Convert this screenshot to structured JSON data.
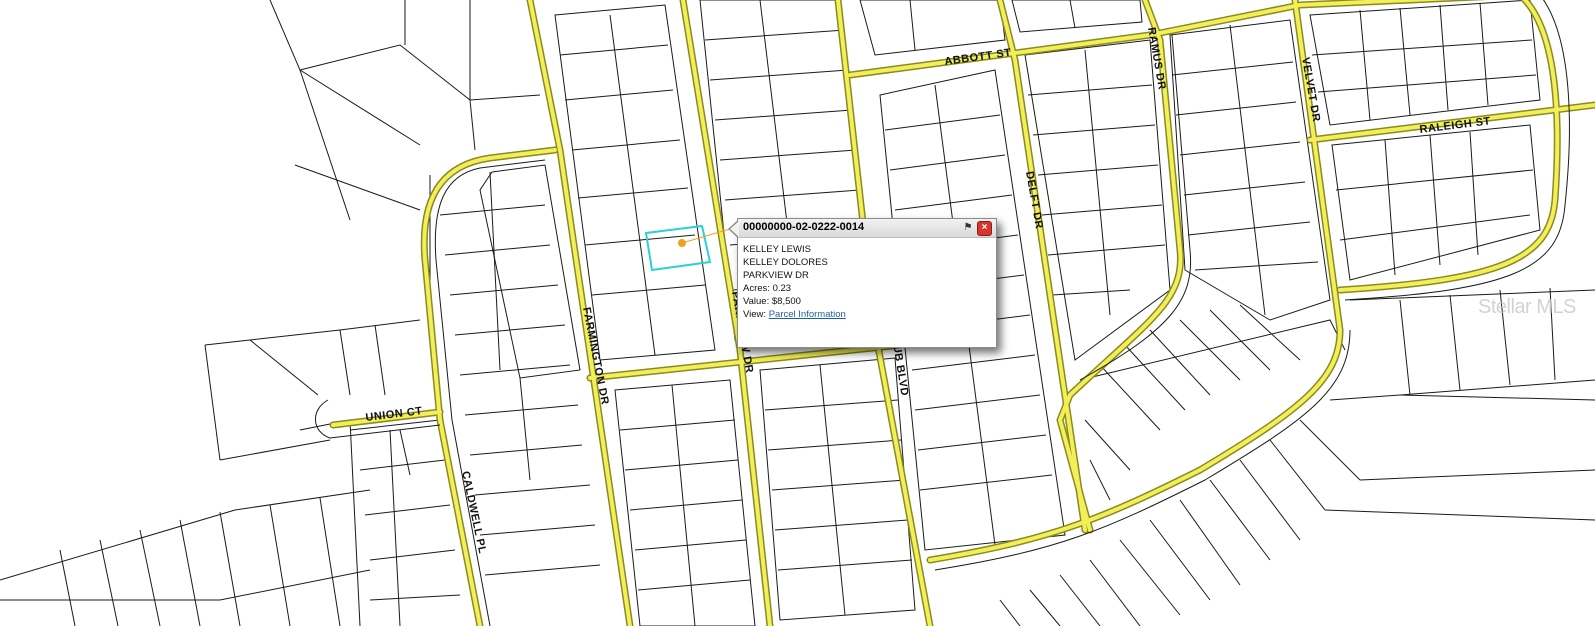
{
  "map": {
    "roads": {
      "abbott": "ABBOTT ST",
      "ramus": "RAMUS DR",
      "velvet": "VELVET DR",
      "raleigh": "RALEIGH ST",
      "delft": "DELFT DR",
      "farmington": "FARMINGTON DR",
      "parkview": "PARKVIEW DR",
      "club": "CLUB BLVD",
      "union": "UNION CT",
      "caldwell": "CALDWELL PL"
    },
    "colors": {
      "road_fill": "#f2ef5a",
      "road_edge": "#8a8a20",
      "parcel_line": "#1a1a1a",
      "selected_parcel": "#2ccfd6",
      "marker": "#f0a020"
    }
  },
  "popup": {
    "parcel_id": "00000000-02-0222-0014",
    "owner_line_1": "KELLEY LEWIS",
    "owner_line_2": "KELLEY DOLORES",
    "address": "PARKVIEW DR",
    "acres_label": "Acres:",
    "acres_value": "0.23",
    "value_label": "Value:",
    "value_value": "$8,500",
    "view_label": "View:",
    "view_link": "Parcel Information"
  },
  "watermark": "Stellar MLS"
}
